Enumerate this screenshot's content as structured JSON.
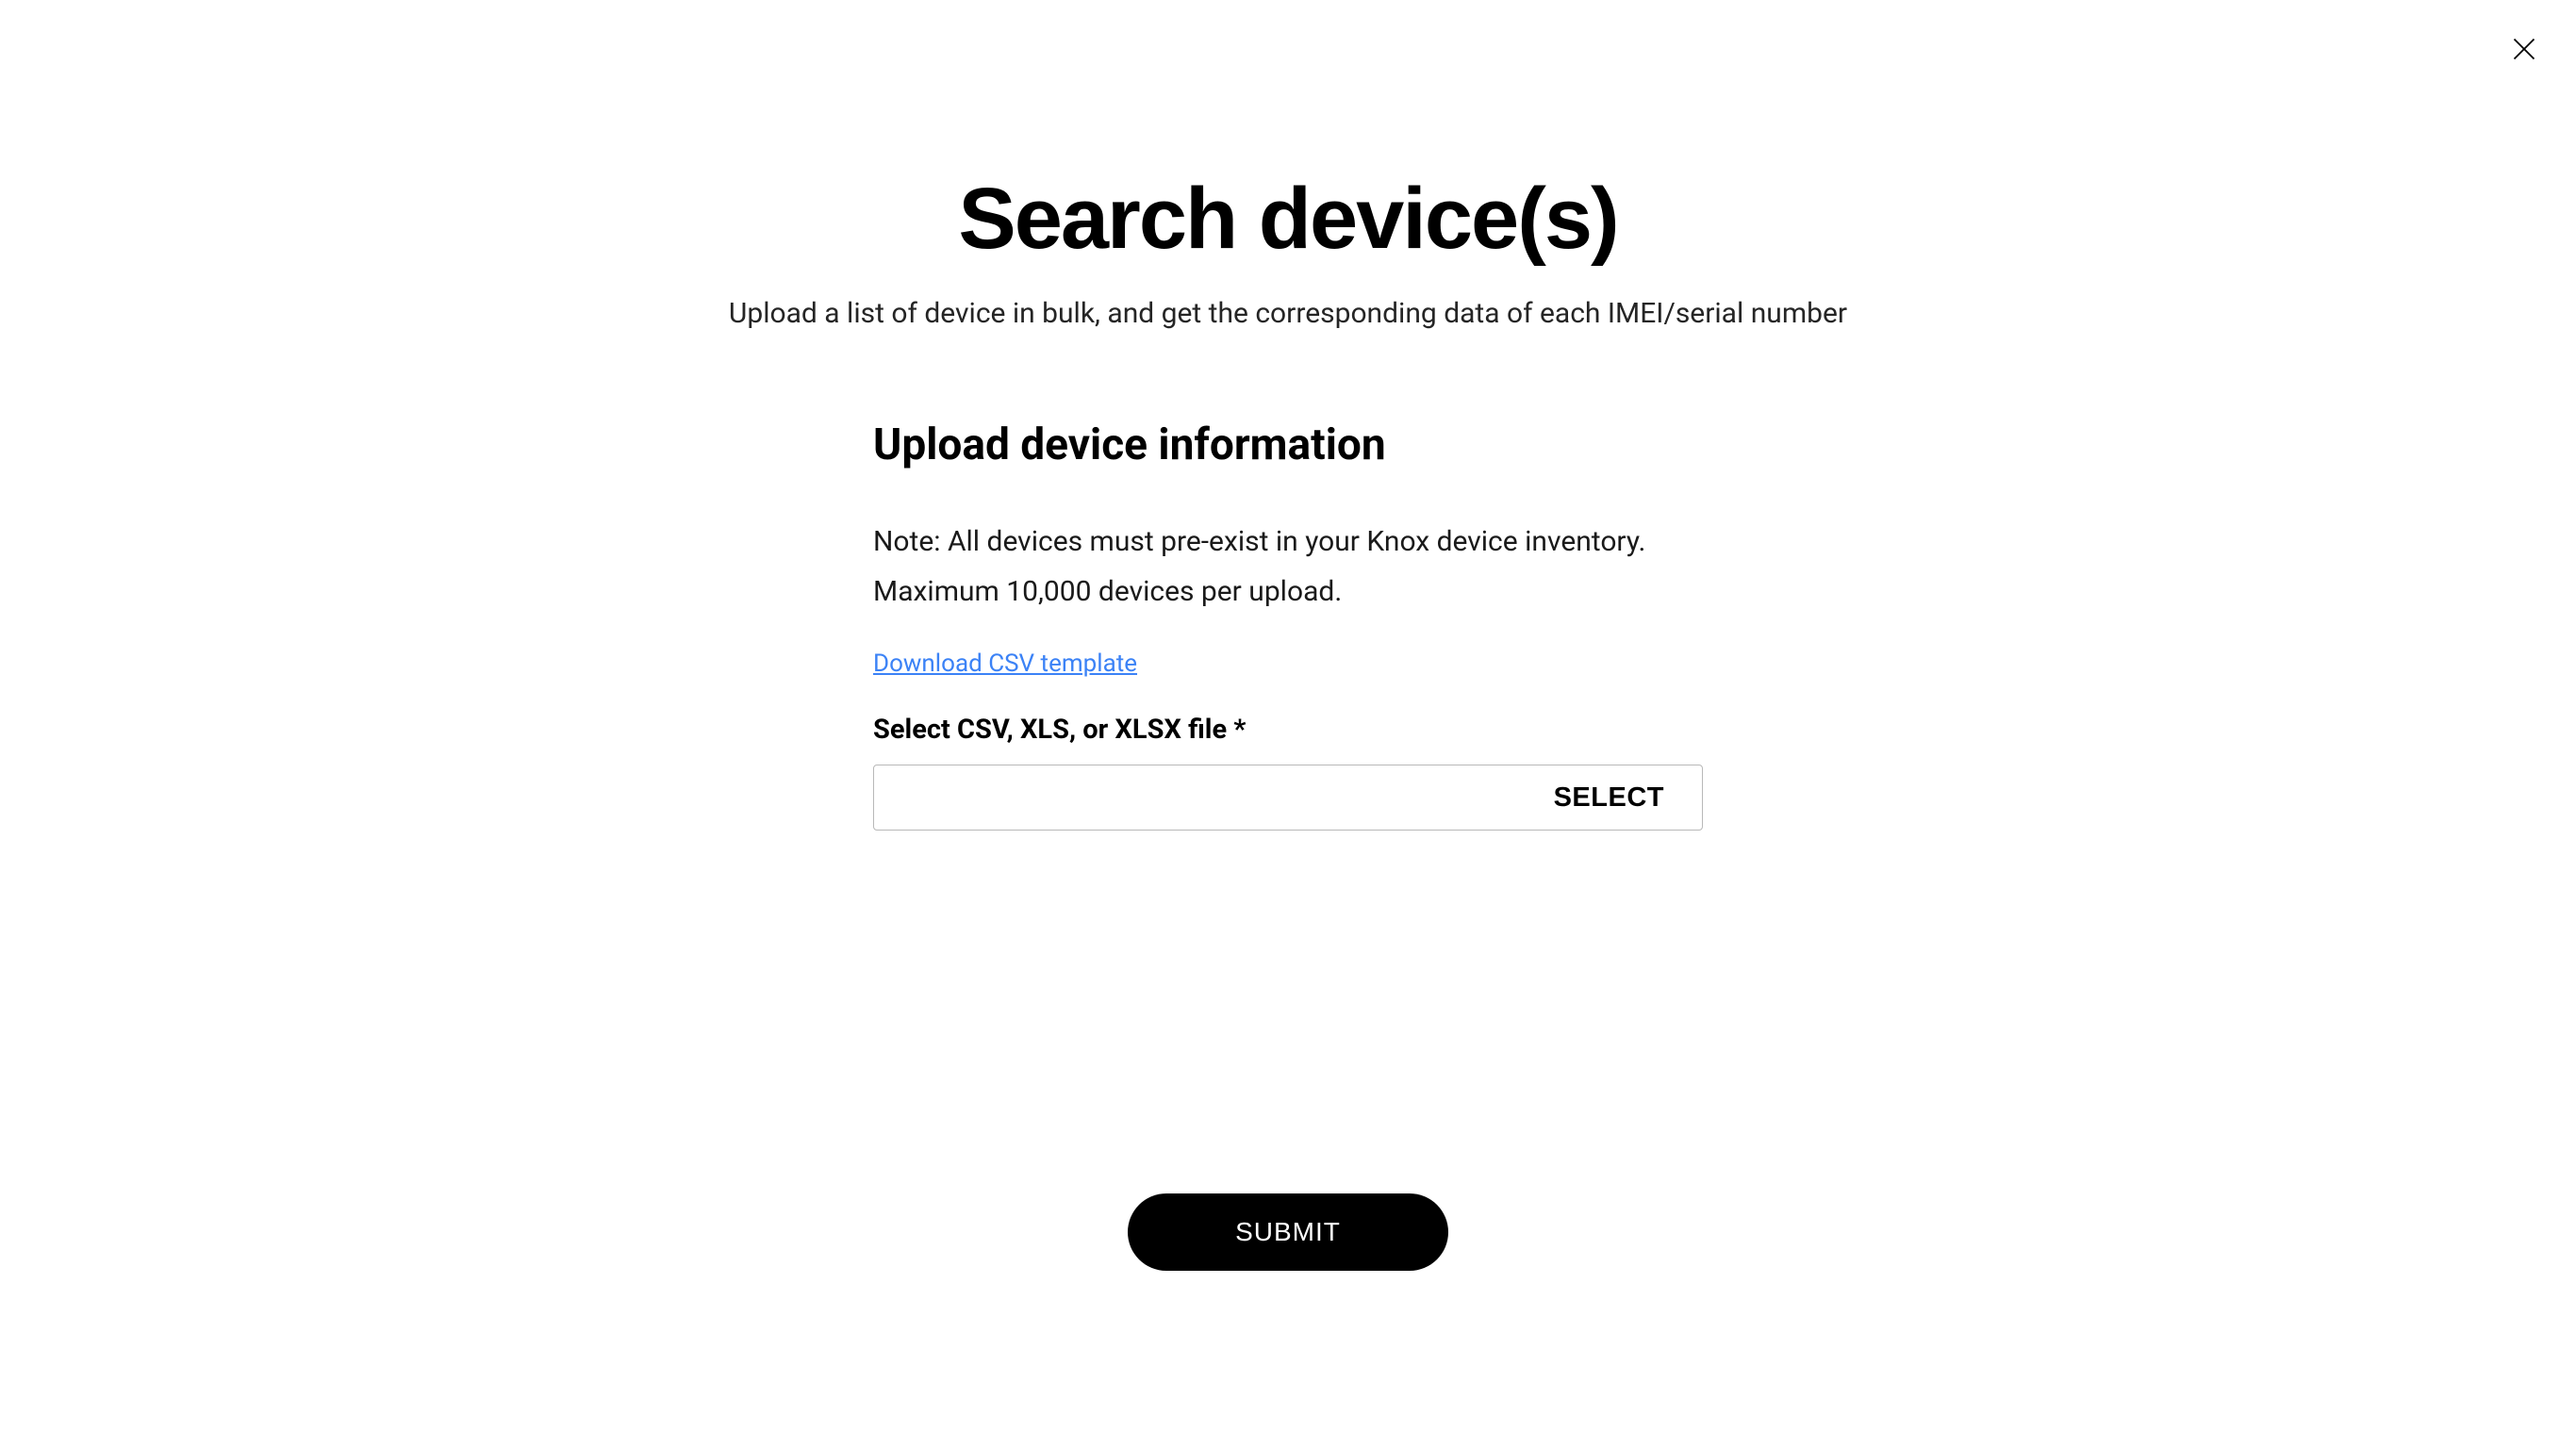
{
  "header": {
    "title": "Search device(s)",
    "subtitle": "Upload a list of device in bulk, and get the corresponding data of each IMEI/serial number"
  },
  "form": {
    "section_title": "Upload device information",
    "note": "Note: All devices must pre-exist in your Knox device inventory. Maximum 10,000 devices per upload.",
    "download_link_label": "Download CSV template",
    "file_label": "Select CSV, XLS, or XLSX file *",
    "select_button_label": "SELECT",
    "file_value": ""
  },
  "actions": {
    "submit_label": "SUBMIT"
  }
}
